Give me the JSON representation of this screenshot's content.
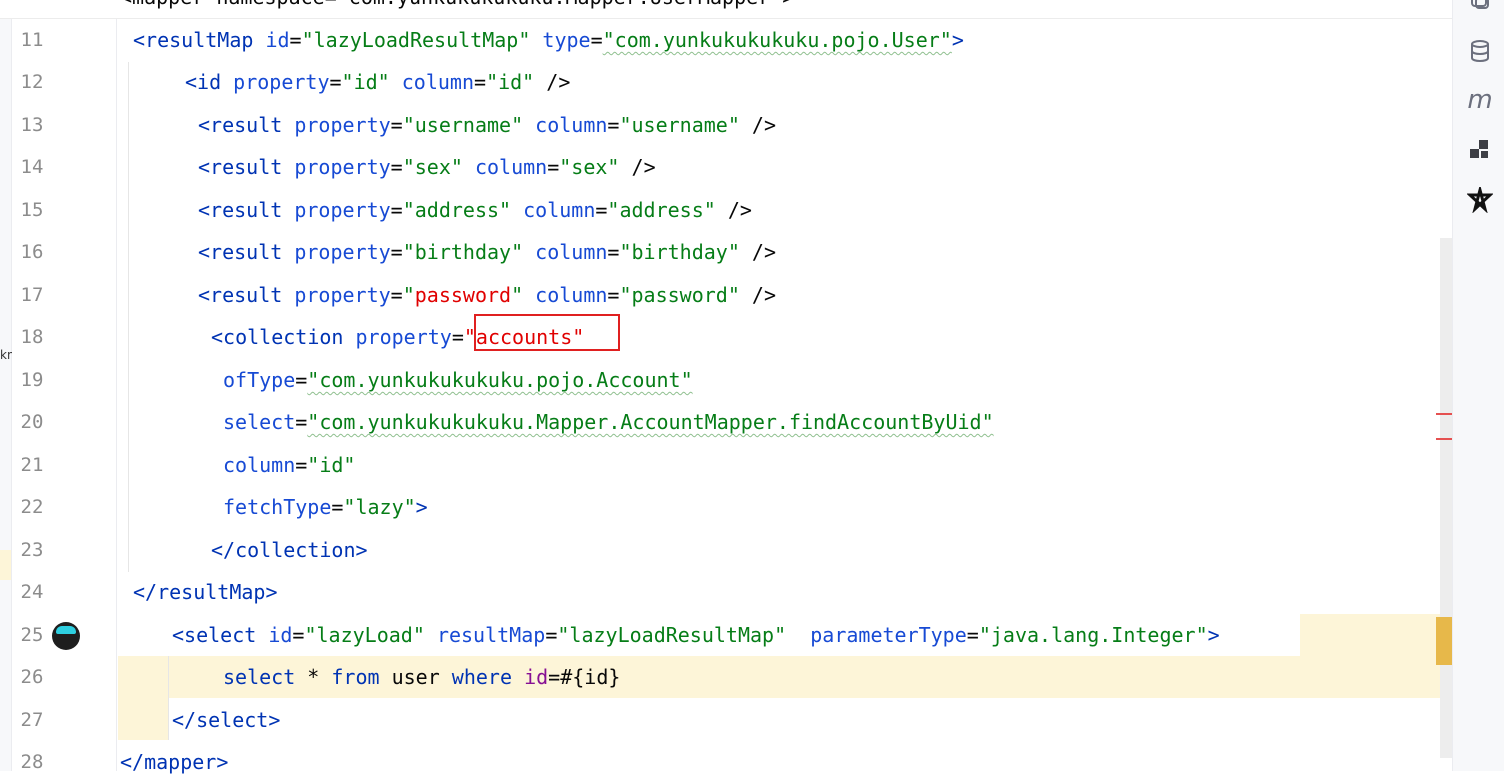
{
  "editor": {
    "top_partial": "<mapper namespace=\"com.yunkukukukuku.Mapper.UserMapper\">",
    "lines": [
      {
        "n": "11",
        "parts": [
          [
            "tag",
            "<resultMap "
          ],
          [
            "attr",
            "id"
          ],
          [
            "plain",
            "="
          ],
          [
            "str",
            "\"lazyLoadResultMap\""
          ],
          [
            "plain",
            " "
          ],
          [
            "attr",
            "type"
          ],
          [
            "plain",
            "="
          ],
          [
            "str",
            "\"com.yunkukukukuku.pojo.User\""
          ],
          [
            "tag",
            ">"
          ]
        ]
      },
      {
        "n": "12",
        "parts": [
          [
            "tag",
            "<id "
          ],
          [
            "attr",
            "property"
          ],
          [
            "plain",
            "="
          ],
          [
            "str",
            "\"id\""
          ],
          [
            "plain",
            " "
          ],
          [
            "attr",
            "column"
          ],
          [
            "plain",
            "="
          ],
          [
            "str",
            "\"id\""
          ],
          [
            "plain",
            " />"
          ]
        ]
      },
      {
        "n": "13",
        "parts": [
          [
            "tag",
            "<result "
          ],
          [
            "attr",
            "property"
          ],
          [
            "plain",
            "="
          ],
          [
            "str",
            "\"username\""
          ],
          [
            "plain",
            " "
          ],
          [
            "attr",
            "column"
          ],
          [
            "plain",
            "="
          ],
          [
            "str",
            "\"username\""
          ],
          [
            "plain",
            " />"
          ]
        ]
      },
      {
        "n": "14",
        "parts": [
          [
            "tag",
            "<result "
          ],
          [
            "attr",
            "property"
          ],
          [
            "plain",
            "="
          ],
          [
            "str",
            "\"sex\""
          ],
          [
            "plain",
            " "
          ],
          [
            "attr",
            "column"
          ],
          [
            "plain",
            "="
          ],
          [
            "str",
            "\"sex\""
          ],
          [
            "plain",
            " />"
          ]
        ]
      },
      {
        "n": "15",
        "parts": [
          [
            "tag",
            "<result "
          ],
          [
            "attr",
            "property"
          ],
          [
            "plain",
            "="
          ],
          [
            "str",
            "\"address\""
          ],
          [
            "plain",
            " "
          ],
          [
            "attr",
            "column"
          ],
          [
            "plain",
            "="
          ],
          [
            "str",
            "\"address\""
          ],
          [
            "plain",
            " />"
          ]
        ]
      },
      {
        "n": "16",
        "parts": [
          [
            "tag",
            "<result "
          ],
          [
            "attr",
            "property"
          ],
          [
            "plain",
            "="
          ],
          [
            "str",
            "\"birthday\""
          ],
          [
            "plain",
            " "
          ],
          [
            "attr",
            "column"
          ],
          [
            "plain",
            "="
          ],
          [
            "str",
            "\"birthday\""
          ],
          [
            "plain",
            " />"
          ]
        ]
      },
      {
        "n": "17",
        "parts": [
          [
            "tag",
            "<result "
          ],
          [
            "attr",
            "property"
          ],
          [
            "plain",
            "="
          ],
          [
            "str",
            "\""
          ],
          [
            "err",
            "password"
          ],
          [
            "str",
            "\""
          ],
          [
            "plain",
            " "
          ],
          [
            "attr",
            "column"
          ],
          [
            "plain",
            "="
          ],
          [
            "str",
            "\"password\""
          ],
          [
            "plain",
            " />"
          ]
        ]
      },
      {
        "n": "18",
        "parts": [
          [
            "tag",
            "<collection "
          ],
          [
            "attr",
            "property"
          ],
          [
            "plain",
            "="
          ],
          [
            "err",
            "\"accounts\""
          ]
        ]
      },
      {
        "n": "19",
        "parts": [
          [
            "attr",
            "ofType"
          ],
          [
            "plain",
            "="
          ],
          [
            "str",
            "\"com.yunkukukukuku.pojo.Account\""
          ]
        ]
      },
      {
        "n": "20",
        "parts": [
          [
            "attr",
            "select"
          ],
          [
            "plain",
            "="
          ],
          [
            "str",
            "\"com.yunkukukukuku.Mapper.AccountMapper.findAccountByUid\""
          ]
        ]
      },
      {
        "n": "21",
        "parts": [
          [
            "attr",
            "column"
          ],
          [
            "plain",
            "="
          ],
          [
            "str",
            "\"id\""
          ]
        ]
      },
      {
        "n": "22",
        "parts": [
          [
            "attr",
            "fetchType"
          ],
          [
            "plain",
            "="
          ],
          [
            "str",
            "\"lazy\""
          ],
          [
            "tag",
            ">"
          ]
        ]
      },
      {
        "n": "23",
        "parts": [
          [
            "tag",
            "</collection>"
          ]
        ]
      },
      {
        "n": "24",
        "parts": [
          [
            "tag",
            "</resultMap>"
          ]
        ]
      },
      {
        "n": "25",
        "parts": [
          [
            "tag",
            "<select "
          ],
          [
            "attr",
            "id"
          ],
          [
            "plain",
            "="
          ],
          [
            "str",
            "\"lazyLoad\""
          ],
          [
            "plain",
            " "
          ],
          [
            "attr",
            "resultMap"
          ],
          [
            "plain",
            "="
          ],
          [
            "str",
            "\"lazyLoadResultMap\""
          ],
          [
            "plain",
            "  "
          ],
          [
            "attr",
            "parameterType"
          ],
          [
            "plain",
            "="
          ],
          [
            "str",
            "\"java.lang.Integer\""
          ],
          [
            "tag",
            ">"
          ]
        ]
      },
      {
        "n": "26",
        "parts": [
          [
            "kw",
            "select"
          ],
          [
            "plain",
            " * "
          ],
          [
            "kw",
            "from"
          ],
          [
            "plain",
            " user "
          ],
          [
            "kw",
            "where"
          ],
          [
            "plain",
            " "
          ],
          [
            "pur",
            "id"
          ],
          [
            "plain",
            "=#{id}"
          ]
        ]
      },
      {
        "n": "27",
        "parts": [
          [
            "tag",
            "</select>"
          ]
        ]
      },
      {
        "n": "28",
        "parts": [
          [
            "tag",
            "</mapper>"
          ]
        ]
      }
    ]
  },
  "left_strip_text": "kn",
  "right_toolbar": [
    {
      "name": "copilot-icon"
    },
    {
      "name": "database-icon"
    },
    {
      "name": "maven-icon",
      "glyph": "m"
    },
    {
      "name": "plugin-icon"
    },
    {
      "name": "mybatis-icon"
    }
  ]
}
